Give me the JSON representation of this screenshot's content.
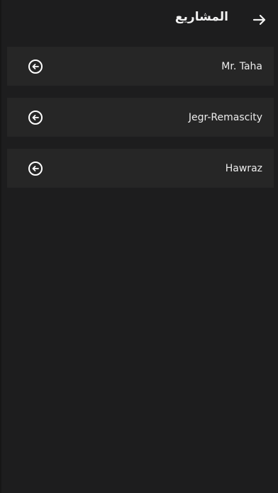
{
  "header": {
    "title": "المشاريع",
    "back_icon": "arrow-right-icon"
  },
  "projects": [
    {
      "name": "Mr. Taha",
      "icon": "arrow-left-circle-icon"
    },
    {
      "name": "Jegr-Remascity",
      "icon": "arrow-left-circle-icon"
    },
    {
      "name": "Hawraz",
      "icon": "arrow-left-circle-icon"
    }
  ],
  "colors": {
    "background": "#1d1d1e",
    "card": "#262626",
    "text": "#ededed"
  }
}
